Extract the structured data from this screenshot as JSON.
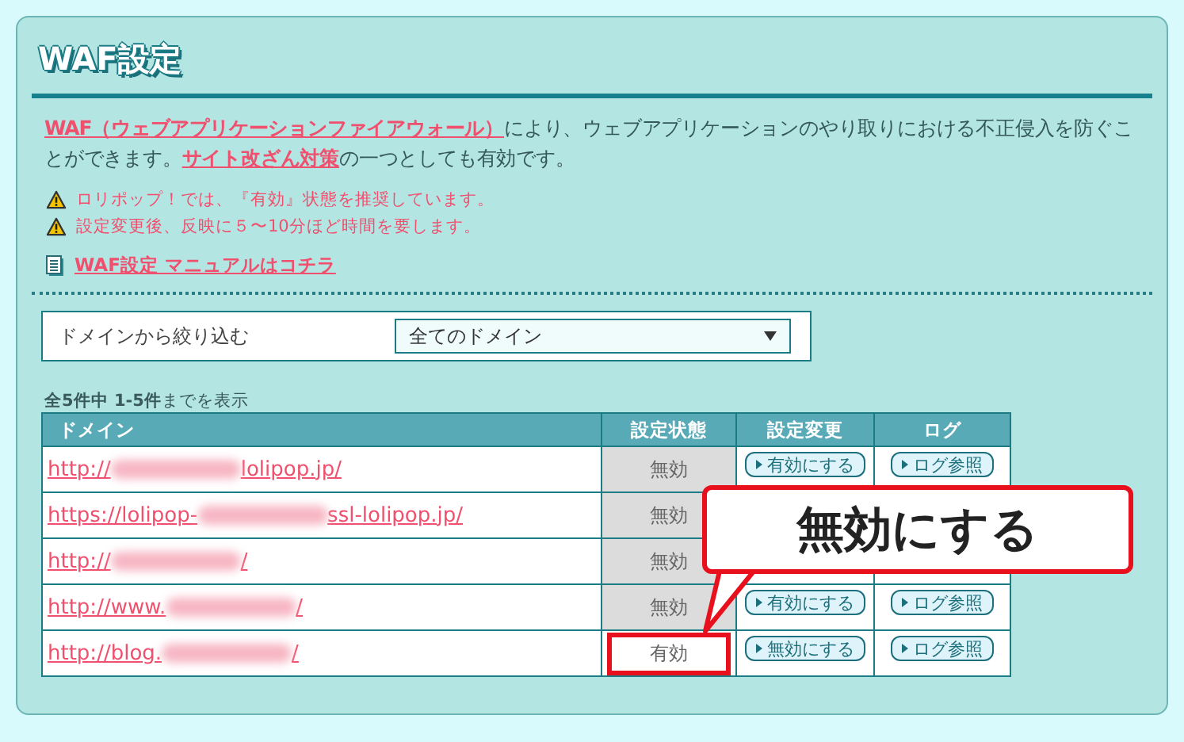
{
  "panel": {
    "title": "WAF設定"
  },
  "intro": {
    "link1": "WAF（ウェブアプリケーションファイアウォール）",
    "text1": "により、ウェブアプリケーションのやり取りにおける不正侵入を防ぐことができます。",
    "link2": "サイト改ざん対策",
    "text2": "の一つとしても有効です。"
  },
  "warnings": [
    "ロリポップ！では、『有効』状態を推奨しています。",
    "設定変更後、反映に５〜10分ほど時間を要します。"
  ],
  "manual_link": "WAF設定 マニュアルはコチラ",
  "filter": {
    "label": "ドメインから絞り込む",
    "value": "全てのドメイン"
  },
  "count": {
    "bold": "全5件中 1-5件",
    "rest": "までを表示"
  },
  "table": {
    "columns": [
      "ドメイン",
      "設定状態",
      "設定変更",
      "ログ"
    ],
    "rows": [
      {
        "prefix": "http://",
        "redacted": true,
        "suffix": "lolipop.jp/",
        "status": "無効",
        "enabled": false,
        "highlighted": false,
        "action": "有効にする",
        "log": "ログ参照"
      },
      {
        "prefix": "https://lolipop-",
        "redacted": true,
        "suffix": "ssl-lolipop.jp/",
        "status": "無効",
        "enabled": false,
        "highlighted": false
      },
      {
        "prefix": "http://",
        "redacted": true,
        "suffix": "/",
        "status": "無効",
        "enabled": false,
        "highlighted": false
      },
      {
        "prefix": "http://www.",
        "redacted": true,
        "suffix": "/",
        "status": "無効",
        "enabled": false,
        "highlighted": false,
        "action": "有効にする",
        "log": "ログ参照"
      },
      {
        "prefix": "http://blog.",
        "redacted": true,
        "suffix": "/",
        "status": "有効",
        "enabled": true,
        "highlighted": true,
        "action": "無効にする",
        "log": "ログ参照"
      }
    ]
  },
  "callout": "無効にする"
}
